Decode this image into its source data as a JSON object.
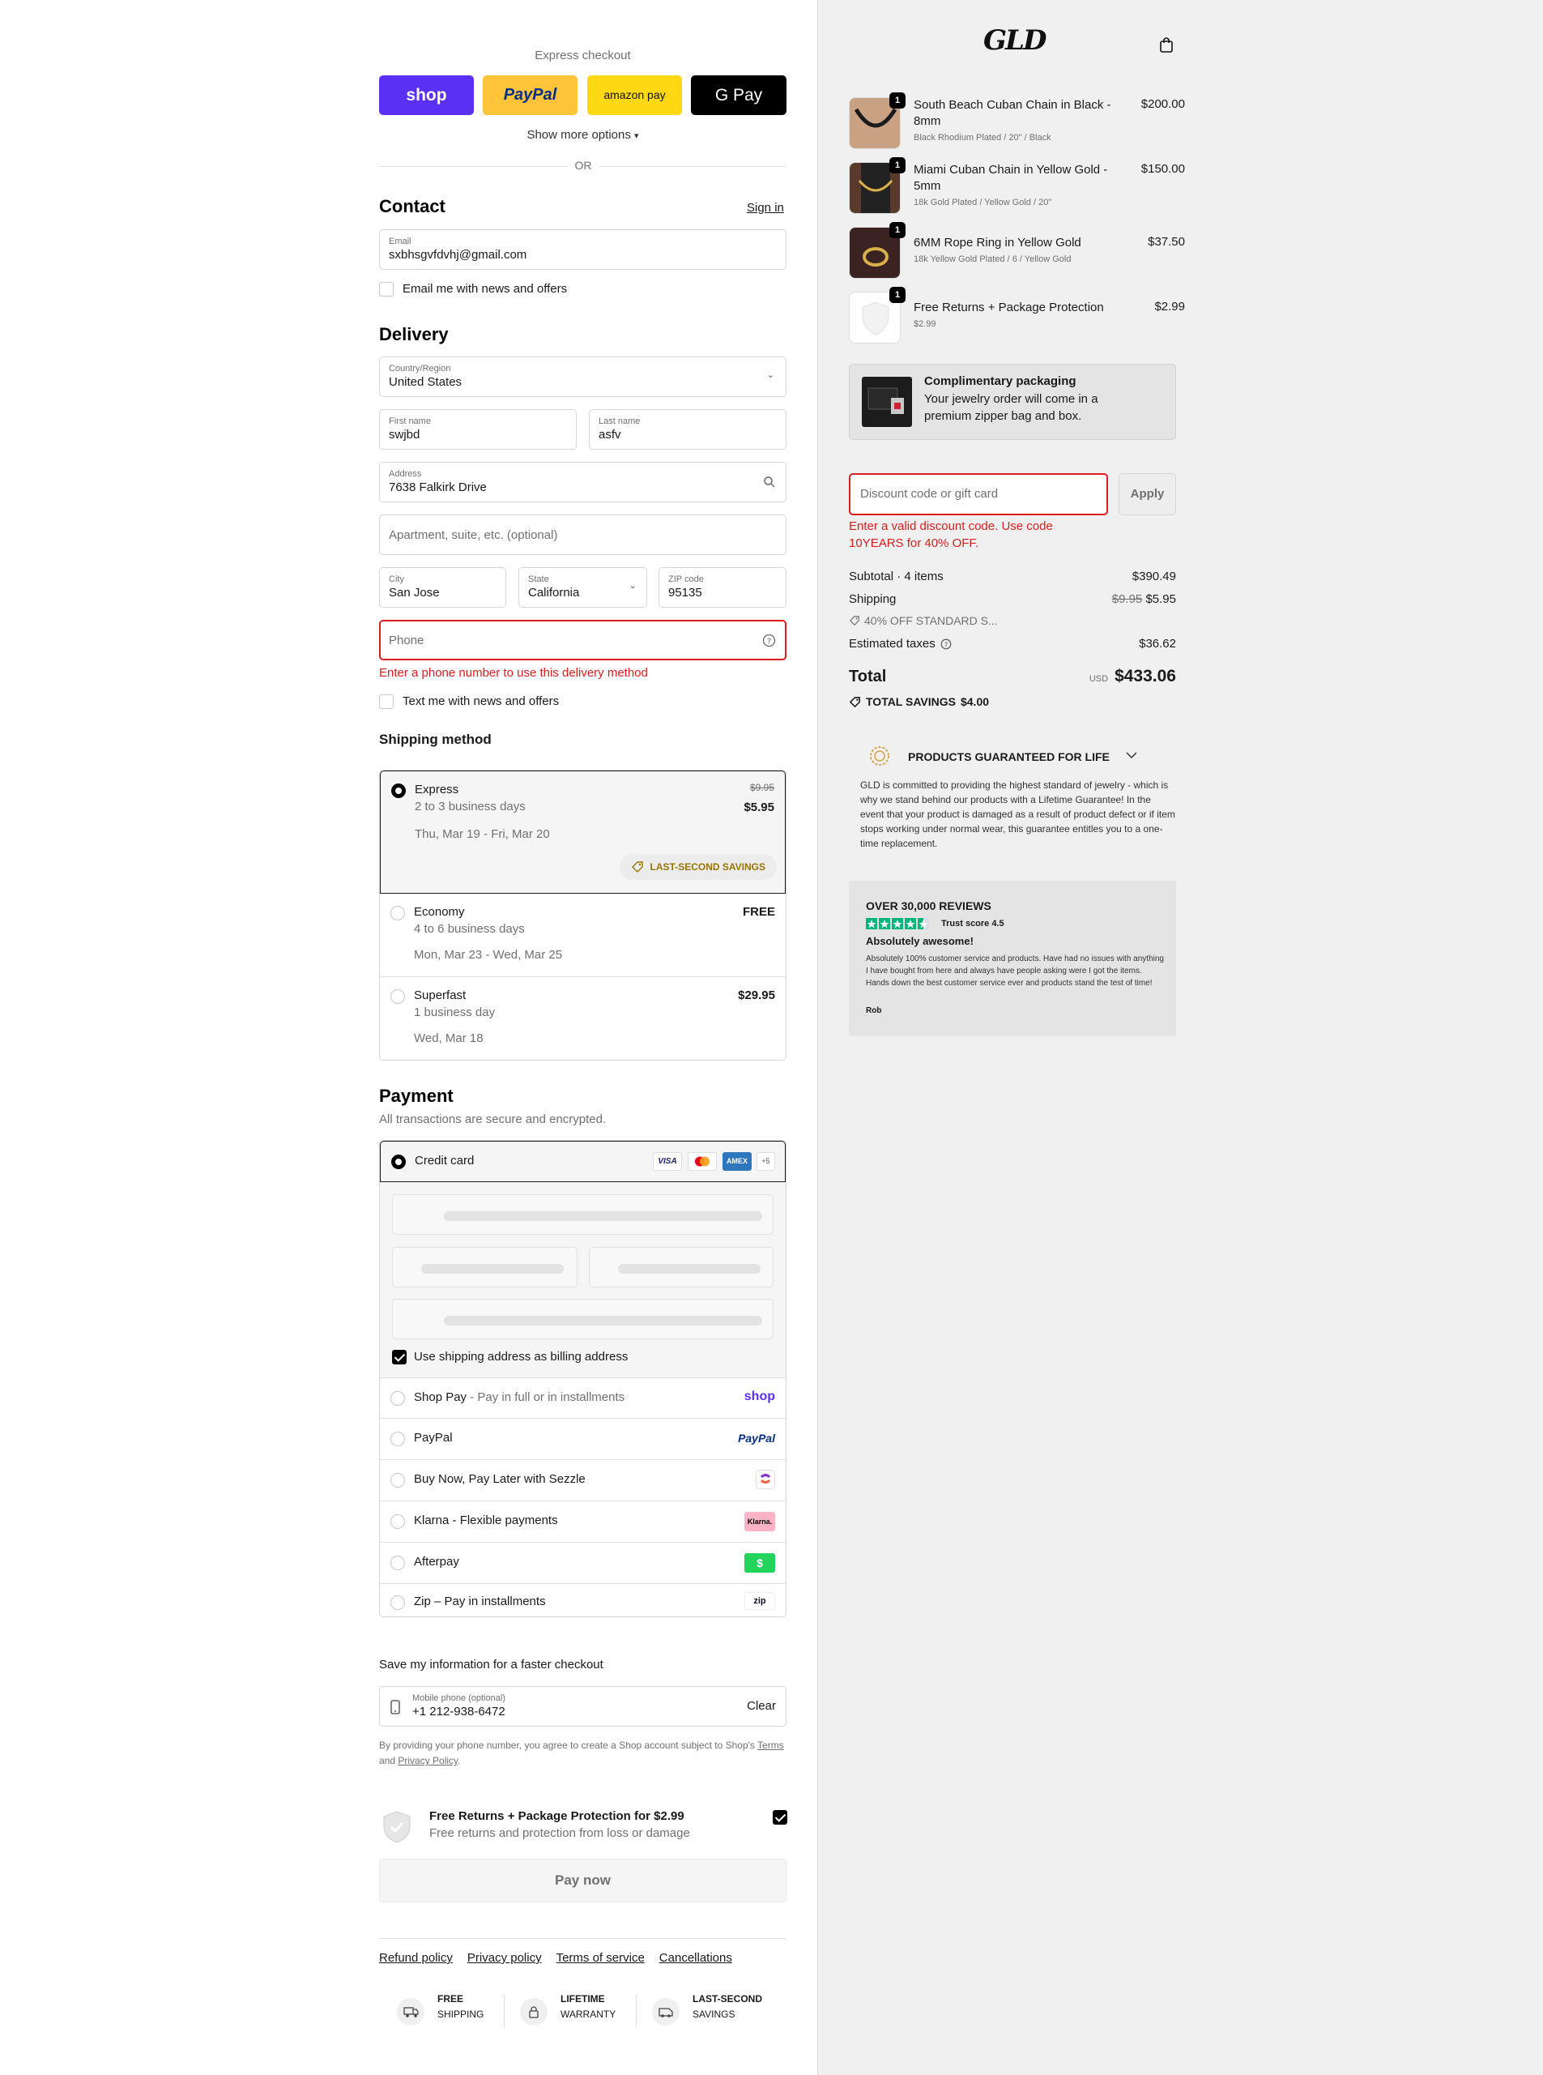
{
  "express": {
    "title": "Express checkout",
    "shop": "shop",
    "paypal": "PayPal",
    "amazon": "amazon pay",
    "gpay": "G Pay",
    "more": "Show more options",
    "or": "OR"
  },
  "contact": {
    "title": "Contact",
    "signin": "Sign in",
    "email_label": "Email",
    "email_value": "sxbhsgvfdvhj@gmail.com",
    "news": "Email me with news and offers"
  },
  "delivery": {
    "title": "Delivery",
    "country_label": "Country/Region",
    "country_value": "United States",
    "first_label": "First name",
    "first_value": "swjbd",
    "last_label": "Last name",
    "last_value": "asfv",
    "address_label": "Address",
    "address_value": "7638 Falkirk Drive",
    "apt_placeholder": "Apartment, suite, etc. (optional)",
    "city_label": "City",
    "city_value": "San Jose",
    "state_label": "State",
    "state_value": "California",
    "zip_label": "ZIP code",
    "zip_value": "95135",
    "phone_placeholder": "Phone",
    "phone_error": "Enter a phone number to use this delivery method",
    "text_news": "Text me with news and offers"
  },
  "shipping": {
    "title": "Shipping method",
    "options": [
      {
        "name": "Express",
        "eta": "2 to 3 business days",
        "dates": "Thu, Mar 19 - Fri, Mar 20",
        "old_price": "$9.95",
        "price": "$5.95",
        "badge": "LAST-SECOND SAVINGS",
        "selected": true
      },
      {
        "name": "Economy",
        "eta": "4 to 6 business days",
        "dates": "Mon, Mar 23 - Wed, Mar 25",
        "price": "FREE",
        "selected": false
      },
      {
        "name": "Superfast",
        "eta": "1 business day",
        "dates": "Wed, Mar 18",
        "price": "$29.95",
        "selected": false
      }
    ]
  },
  "payment": {
    "title": "Payment",
    "subtitle": "All transactions are secure and encrypted.",
    "card_label": "Credit card",
    "visa": "VISA",
    "amex": "AMEX",
    "more_cards": "+5",
    "billing": "Use shipping address as billing address",
    "shoppay": "Shop Pay",
    "shoppay_sub": " - Pay in full or in installments",
    "shoppay_logo": "shop",
    "paypal": "PayPal",
    "paypal_logo": "PayPal",
    "sezzle": "Buy Now, Pay Later with Sezzle",
    "klarna": "Klarna - Flexible payments",
    "klarna_logo": "Klarna.",
    "afterpay": "Afterpay",
    "afterpay_logo": "$",
    "zip": "Zip – Pay in installments",
    "zip_logo": "zip"
  },
  "save": {
    "title": "Save my information for a faster checkout",
    "phone_label": "Mobile phone (optional)",
    "phone_value": "+1 212-938-6472",
    "clear": "Clear",
    "legal_1": "By providing your phone number, you agree to create a Shop account subject to Shop's ",
    "terms": "Terms",
    "and": " and ",
    "privacy": "Privacy Policy",
    "dot": "."
  },
  "protection": {
    "title": "Free Returns + Package Protection for $2.99",
    "subtitle": "Free returns and protection from loss or damage"
  },
  "paynow": "Pay now",
  "footer_links": [
    "Refund policy",
    "Privacy policy",
    "Terms of service",
    "Cancellations"
  ],
  "perks": [
    {
      "line1": "FREE",
      "line2": "SHIPPING",
      "icon": "truck-icon"
    },
    {
      "line1": "LIFETIME",
      "line2": "WARRANTY",
      "icon": "lock-icon"
    },
    {
      "line1": "LAST-SECOND",
      "line2": "SAVINGS",
      "icon": "van-icon"
    }
  ],
  "brand": {
    "logo": "GLD"
  },
  "items": [
    {
      "name": "South Beach Cuban Chain in Black - 8mm",
      "variant": "Black Rhodium Plated / 20\" / Black",
      "price": "$200.00",
      "qty": "1"
    },
    {
      "name": "Miami Cuban Chain in Yellow Gold - 5mm",
      "variant": "18k Gold Plated / Yellow Gold / 20\"",
      "price": "$150.00",
      "qty": "1"
    },
    {
      "name": "6MM Rope Ring in Yellow Gold",
      "variant": "18k Yellow Gold Plated / 6 / Yellow Gold",
      "price": "$37.50",
      "qty": "1"
    },
    {
      "name": "Free Returns + Package Protection",
      "variant": "$2.99",
      "price": "$2.99",
      "qty": "1"
    }
  ],
  "packaging": {
    "title": "Complimentary packaging",
    "text": "Your jewelry order will come in a premium zipper bag and box."
  },
  "discount": {
    "placeholder": "Discount code or gift card",
    "apply": "Apply",
    "error": "Enter a valid discount code. Use code 10YEARS for 40% OFF."
  },
  "totals": {
    "subtotal_label": "Subtotal · 4 items",
    "subtotal": "$390.49",
    "shipping_label": "Shipping",
    "shipping_old": "$9.95",
    "shipping": "$5.95",
    "discount_tag": "40% OFF STANDARD S...",
    "taxes_label": "Estimated taxes",
    "taxes": "$36.62",
    "total_label": "Total",
    "currency": "USD",
    "total": "$433.06",
    "savings_label": "TOTAL SAVINGS",
    "savings": "$4.00"
  },
  "guarantee": {
    "title": "PRODUCTS GUARANTEED FOR LIFE",
    "text": "GLD is committed to providing the highest standard of jewelry - which is why we stand behind our products with a Lifetime Guarantee! In the event that your product is damaged as a result of product defect or if item stops working under normal wear, this guarantee entitles you to a one-time replacement."
  },
  "reviews": {
    "title": "OVER 30,000 REVIEWS",
    "trust": "Trust score 4.5",
    "headline": "Absolutely awesome!",
    "body": "Absolutely 100% customer service and products. Have had no issues with anything I have bought from here and always have people asking were I got the items. Hands down the best customer service ever and products stand the test of time!",
    "author": "Rob",
    "stars": 4.5
  }
}
